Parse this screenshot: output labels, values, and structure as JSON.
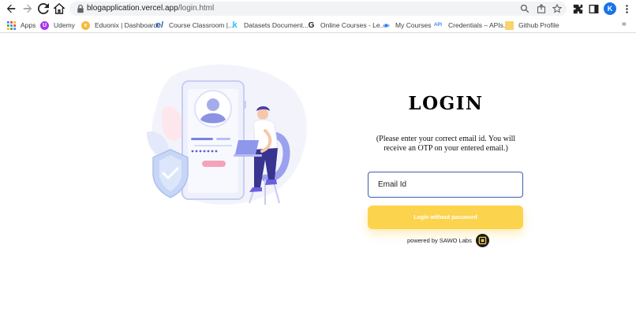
{
  "browser": {
    "url_host": "blogapplication.vercel.app",
    "url_path": "/login.html",
    "profile_initial": "K",
    "accent_color": "#1a73e8"
  },
  "bookmarks": {
    "items": [
      {
        "label": "Apps",
        "icon": "apps-grid-icon"
      },
      {
        "label": "Udemy",
        "icon": "udemy-icon"
      },
      {
        "label": "Eduonix | Dashboard",
        "icon": "eduonix-icon"
      },
      {
        "label": "Course Classroom |...",
        "icon": "e-icon"
      },
      {
        "label": "Datasets Document...",
        "icon": "k-icon"
      },
      {
        "label": "Online Courses - Le...",
        "icon": "g-icon"
      },
      {
        "label": "My Courses",
        "icon": "eye-icon"
      },
      {
        "label": "Credentials – APIs...",
        "icon": "api-icon"
      },
      {
        "label": "Github Profile",
        "icon": "folder-icon"
      }
    ],
    "more": "»"
  },
  "login": {
    "title": "LOGIN",
    "description": "(Please enter your correct email id. You will receive an OTP on your entered email.)",
    "email_placeholder": "Email Id",
    "email_value": "",
    "button_label": "Login without password",
    "powered_by": "powered by SAWO Labs",
    "button_color": "#fcd34d",
    "input_border_color": "#3b5ea8"
  }
}
